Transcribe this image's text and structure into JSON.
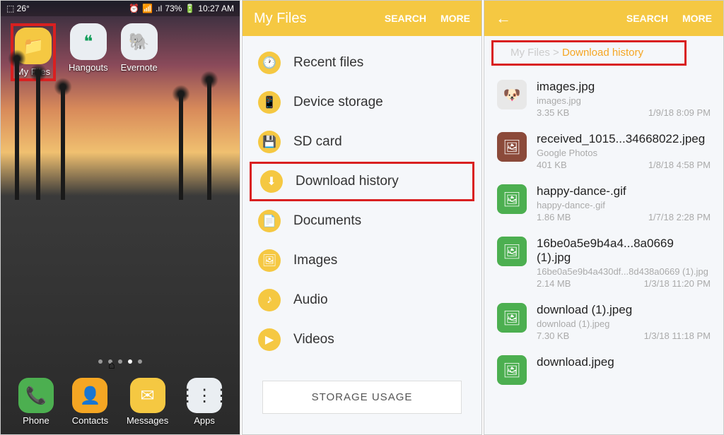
{
  "status": {
    "left_icons": "⬚ 26°",
    "alarm": "⏰",
    "wifi": "📶",
    "signal": "📶",
    "battery_pct": "73%",
    "battery_icon": "🔋",
    "time": "10:27 AM"
  },
  "home": {
    "apps_top": [
      {
        "name": "My Files",
        "icon_class": "ic-files",
        "glyph": "📁",
        "hl": true
      },
      {
        "name": "Hangouts",
        "icon_class": "ic-hangouts",
        "glyph": "❝",
        "hl": false
      },
      {
        "name": "Evernote",
        "icon_class": "ic-evernote",
        "glyph": "🐘",
        "hl": false
      }
    ],
    "dock": [
      {
        "name": "Phone",
        "icon_class": "ic-phone",
        "glyph": "📞"
      },
      {
        "name": "Contacts",
        "icon_class": "ic-contacts",
        "glyph": "👤"
      },
      {
        "name": "Messages",
        "icon_class": "ic-messages",
        "glyph": "✉"
      },
      {
        "name": "Apps",
        "icon_class": "ic-apps",
        "glyph": "⋮⋮⋮"
      }
    ]
  },
  "myfiles": {
    "title": "My Files",
    "search": "SEARCH",
    "more": "MORE",
    "categories": [
      {
        "label": "Recent files",
        "glyph": "🕐",
        "hl": false
      },
      {
        "label": "Device storage",
        "glyph": "📱",
        "hl": false
      },
      {
        "label": "SD card",
        "glyph": "💾",
        "hl": false
      },
      {
        "label": "Download history",
        "glyph": "⬇",
        "hl": true
      },
      {
        "label": "Documents",
        "glyph": "📄",
        "hl": false
      },
      {
        "label": "Images",
        "glyph": "🖼",
        "hl": false
      },
      {
        "label": "Audio",
        "glyph": "♪",
        "hl": false
      },
      {
        "label": "Videos",
        "glyph": "▶",
        "hl": false
      }
    ],
    "storage_btn": "STORAGE USAGE"
  },
  "downloads": {
    "search": "SEARCH",
    "more": "MORE",
    "bc_root": "My Files",
    "bc_sep": ">",
    "bc_cur": "Download history",
    "files": [
      {
        "name": "images.jpg",
        "sub": "images.jpg",
        "size": "3.35 KB",
        "date": "1/9/18 8:09 PM",
        "thumb": "photo1",
        "glyph": "🐶"
      },
      {
        "name": "received_1015...34668022.jpeg",
        "sub": "Google Photos",
        "size": "401 KB",
        "date": "1/8/18 4:58 PM",
        "thumb": "photo2",
        "glyph": "🖼"
      },
      {
        "name": "happy-dance-.gif",
        "sub": "happy-dance-.gif",
        "size": "1.86 MB",
        "date": "1/7/18 2:28 PM",
        "thumb": "green",
        "glyph": "🖼"
      },
      {
        "name": "16be0a5e9b4a4...8a0669 (1).jpg",
        "sub": "16be0a5e9b4a430df...8d438a0669 (1).jpg",
        "size": "2.14 MB",
        "date": "1/3/18 11:20 PM",
        "thumb": "green",
        "glyph": "🖼"
      },
      {
        "name": "download (1).jpeg",
        "sub": "download (1).jpeg",
        "size": "7.30 KB",
        "date": "1/3/18 11:18 PM",
        "thumb": "green",
        "glyph": "🖼"
      },
      {
        "name": "download.jpeg",
        "sub": "",
        "size": "",
        "date": "",
        "thumb": "green",
        "glyph": "🖼"
      }
    ]
  }
}
